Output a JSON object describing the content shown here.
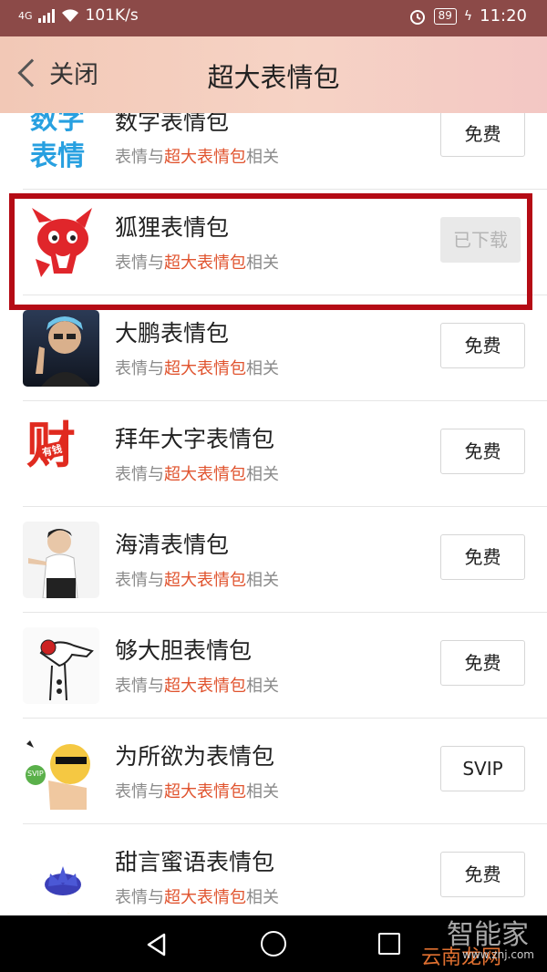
{
  "status_bar": {
    "network": "4G",
    "speed": "101K/s",
    "battery": "89",
    "time": "11:20"
  },
  "header": {
    "back_label": "关闭",
    "title": "超大表情包"
  },
  "items": [
    {
      "name": "数字表情包",
      "desc_prefix": "表情与",
      "desc_highlight": "超大表情包",
      "desc_suffix": "相关",
      "button": "免费",
      "thumb_text_1": "数字",
      "thumb_text_2": "表情"
    },
    {
      "name": "狐狸表情包",
      "desc_prefix": "表情与",
      "desc_highlight": "超大表情包",
      "desc_suffix": "相关",
      "button": "已下载"
    },
    {
      "name": "大鹏表情包",
      "desc_prefix": "表情与",
      "desc_highlight": "超大表情包",
      "desc_suffix": "相关",
      "button": "免费"
    },
    {
      "name": "拜年大字表情包",
      "desc_prefix": "表情与",
      "desc_highlight": "超大表情包",
      "desc_suffix": "相关",
      "button": "免费",
      "thumb_text_1": "财",
      "thumb_text_2": "有钱"
    },
    {
      "name": "海清表情包",
      "desc_prefix": "表情与",
      "desc_highlight": "超大表情包",
      "desc_suffix": "相关",
      "button": "免费"
    },
    {
      "name": "够大胆表情包",
      "desc_prefix": "表情与",
      "desc_highlight": "超大表情包",
      "desc_suffix": "相关",
      "button": "免费"
    },
    {
      "name": "为所欲为表情包",
      "desc_prefix": "表情与",
      "desc_highlight": "超大表情包",
      "desc_suffix": "相关",
      "button": "SVIP",
      "thumb_text_1": "SVIP"
    },
    {
      "name": "甜言蜜语表情包",
      "desc_prefix": "表情与",
      "desc_highlight": "超大表情包",
      "desc_suffix": "相关",
      "button": "免费"
    }
  ],
  "watermark": {
    "line1": "智能家",
    "line2": "云南龙网",
    "line3": "www.znj.com"
  },
  "colors": {
    "status_bar": "#8c4a48",
    "highlight_box": "#b50b15",
    "keyword": "#e0532e"
  }
}
